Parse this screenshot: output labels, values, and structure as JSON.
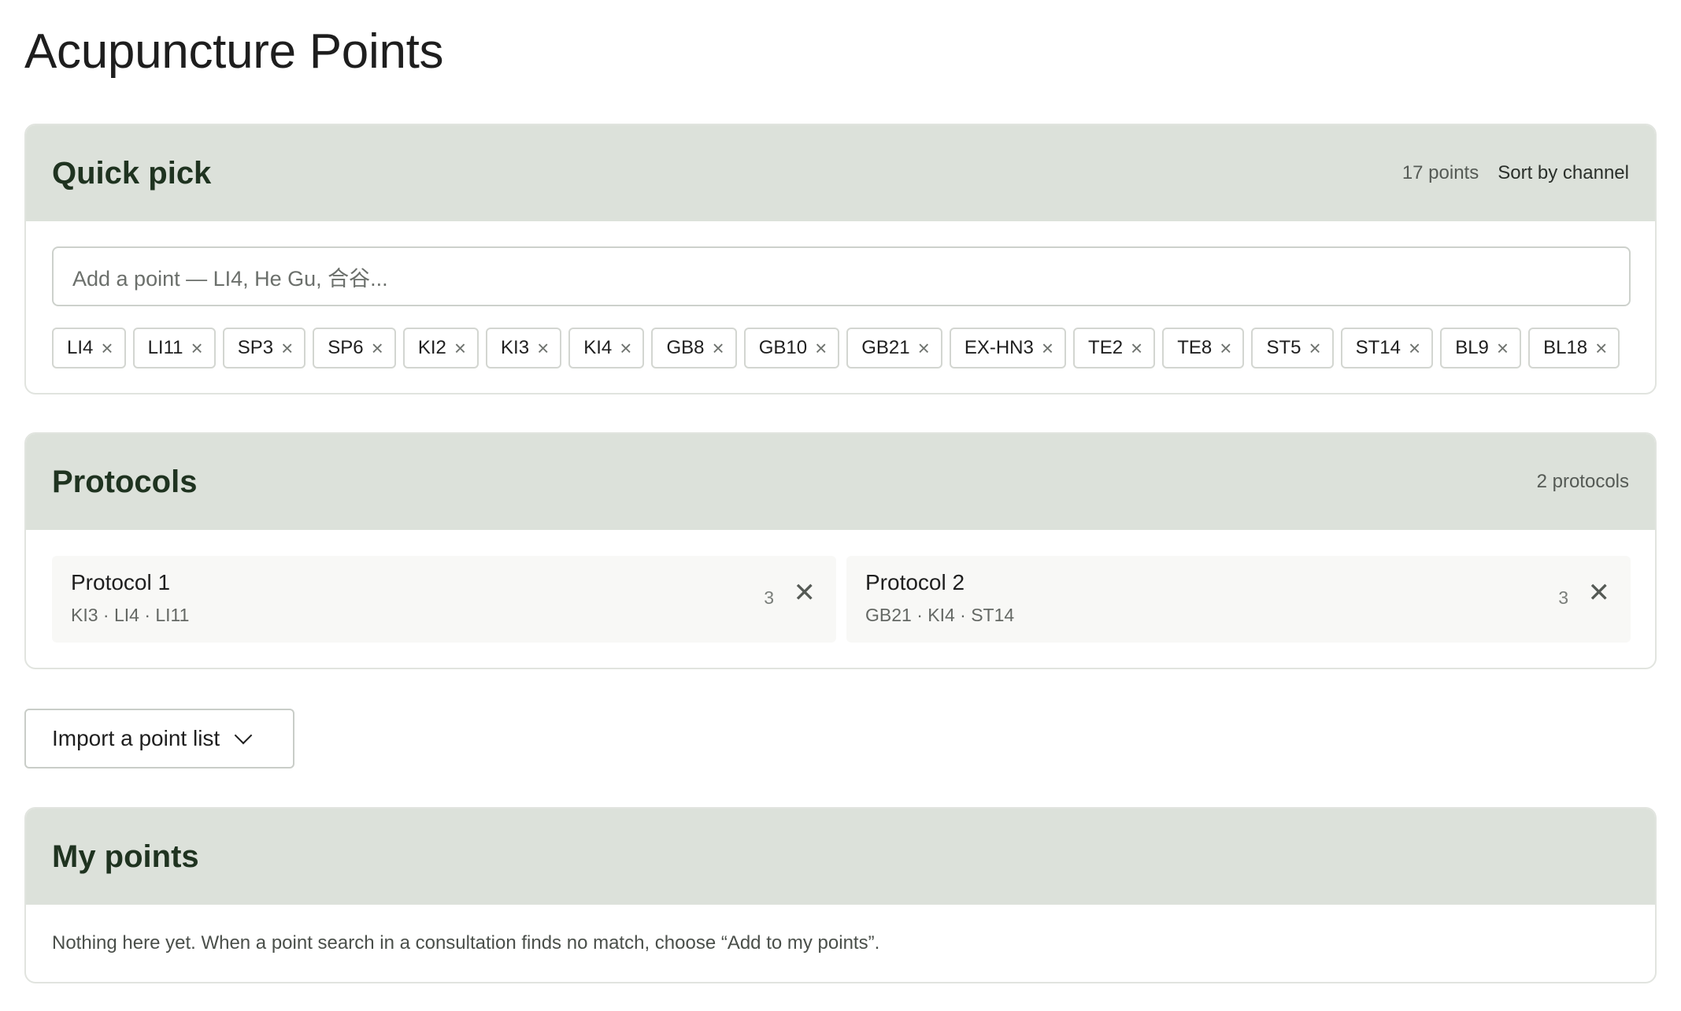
{
  "page": {
    "title": "Acupuncture Points"
  },
  "quick_pick": {
    "title": "Quick pick",
    "count": "17 points",
    "sort_label": "Sort by channel",
    "search_placeholder": "Add a point — LI4, He Gu, 合谷...",
    "chips": [
      "LI4",
      "LI11",
      "SP3",
      "SP6",
      "KI2",
      "KI3",
      "KI4",
      "GB8",
      "GB10",
      "GB21",
      "EX-HN3",
      "TE2",
      "TE8",
      "ST5",
      "ST14",
      "BL9",
      "BL18"
    ],
    "chip_remove_glyph": "×"
  },
  "protocols": {
    "title": "Protocols",
    "count": "2 protocols",
    "items": [
      {
        "name": "Protocol 1",
        "points": "KI3 · LI4 · LI11",
        "count": "3"
      },
      {
        "name": "Protocol 2",
        "points": "GB21 · KI4 · ST14",
        "count": "3"
      }
    ],
    "close_glyph": "✕"
  },
  "import": {
    "label": "Import a point list"
  },
  "my_points": {
    "title": "My points",
    "empty_text": "Nothing here yet. When a point search in a consultation finds no match, choose “Add to my points”."
  },
  "icons": [
    "close-icon",
    "chevron-down-icon"
  ]
}
